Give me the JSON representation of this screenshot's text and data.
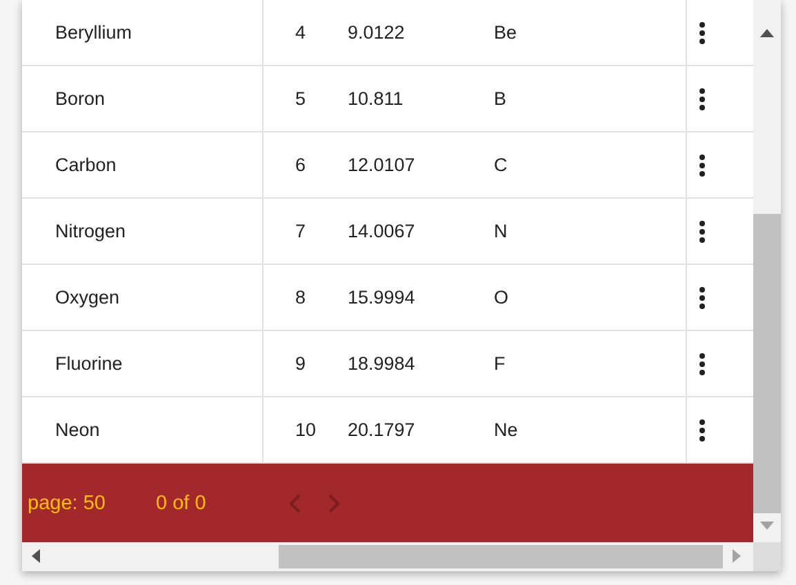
{
  "rows": [
    {
      "cells": [
        "Beryllium",
        "4",
        "9.0122",
        "Be"
      ]
    },
    {
      "cells": [
        "Boron",
        "5",
        "10.811",
        "B"
      ]
    },
    {
      "cells": [
        "Carbon",
        "6",
        "12.0107",
        "C"
      ]
    },
    {
      "cells": [
        "Nitrogen",
        "7",
        "14.0067",
        "N"
      ]
    },
    {
      "cells": [
        "Oxygen",
        "8",
        "15.9994",
        "O"
      ]
    },
    {
      "cells": [
        "Fluorine",
        "9",
        "18.9984",
        "F"
      ]
    },
    {
      "cells": [
        "Neon",
        "10",
        "20.1797",
        "Ne"
      ]
    }
  ],
  "paginator": {
    "page_size": "page: 50",
    "range": "0 of 0",
    "previous_disabled": true,
    "next_disabled": true
  }
}
